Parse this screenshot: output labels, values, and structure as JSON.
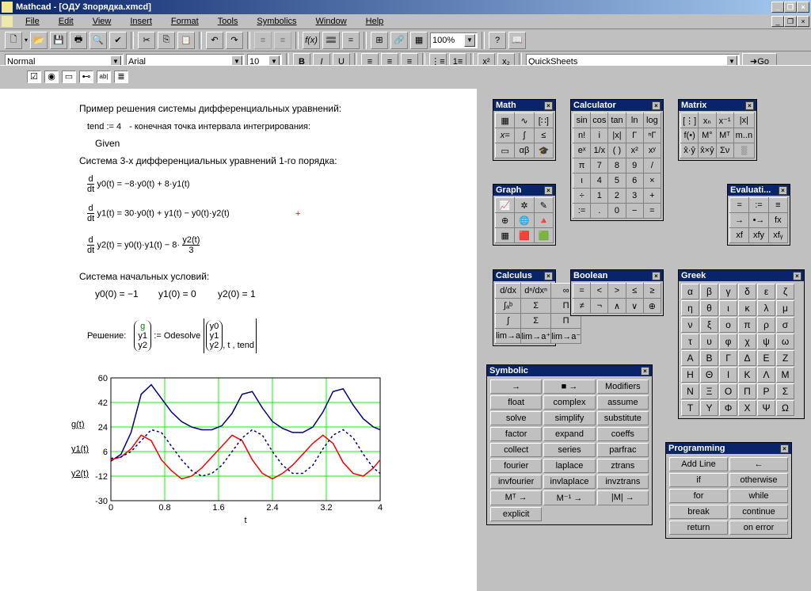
{
  "title": "Mathcad - [ОДУ 3порядка.xmcd]",
  "menu": [
    "File",
    "Edit",
    "View",
    "Insert",
    "Format",
    "Tools",
    "Symbolics",
    "Window",
    "Help"
  ],
  "style_combo": "Normal",
  "font_combo": "Arial",
  "size_combo": "10",
  "zoom_combo": "100%",
  "resources_combo": "QuickSheets",
  "go_label": "Go",
  "doc": {
    "l1": "Пример решения системы дифференциальных уравнений:",
    "l2a": "tend := 4",
    "l2b": "- конечная точка интервала интегрирования:",
    "l3": "Given",
    "l4": "Система  3-х дифференциальных уравнений 1-го порядка:",
    "eq1": "y0(t) = −8·y0(t) + 8·y1(t)",
    "eq2": "y1(t) = 30·y0(t) + y1(t) − y0(t)·y2(t)",
    "eq3_l": "y2(t) = y0(t)·y1(t) − 8·",
    "eq3_num": "y2(t)",
    "eq3_den": "3",
    "l5": "Система  начальных условий:",
    "ic1": "y0(0) = −1",
    "ic2": "y1(0) = 0",
    "ic3": "y2(0) = 1",
    "l6": "Решение:",
    "sol_v": [
      "g",
      "y1",
      "y2"
    ],
    "sol_assign": ":= Odesolve",
    "sol_u": [
      "y0",
      "y1",
      "y2"
    ],
    "sol_tail": ", t , tend",
    "legend": [
      "g(t)",
      "y1(t)",
      "y2(t)"
    ],
    "xlabel": "t"
  },
  "palettes": {
    "math_title": "Math",
    "graph_title": "Graph",
    "calc_title": "Calculator",
    "matrix_title": "Matrix",
    "eval_title": "Evaluati...",
    "calculus_title": "Calculus",
    "bool_title": "Boolean",
    "greek_title": "Greek",
    "symb_title": "Symbolic",
    "prog_title": "Programming",
    "calc_rows": [
      [
        "sin",
        "cos",
        "tan",
        "ln",
        "log"
      ],
      [
        "n!",
        "i",
        "|x|",
        "Γ",
        "ⁿΓ"
      ],
      [
        "eˣ",
        "1/x",
        "( )",
        "x²",
        "xʸ"
      ],
      [
        "π",
        "7",
        "8",
        "9",
        "/"
      ],
      [
        "ι",
        "4",
        "5",
        "6",
        "×"
      ],
      [
        "÷",
        "1",
        "2",
        "3",
        "+"
      ],
      [
        ":=",
        ".",
        "0",
        "−",
        "="
      ]
    ],
    "matrix_rows": [
      [
        "[⋮]",
        "xₙ",
        "x⁻¹",
        "|x|"
      ],
      [
        "f(•)",
        "M°",
        "Mᵀ",
        "m..n"
      ],
      [
        "x̂·ŷ",
        "x̂×ŷ",
        "Σν",
        "░"
      ]
    ],
    "eval_rows": [
      [
        "=",
        ":=",
        "≡"
      ],
      [
        "→",
        "•→",
        "fx"
      ],
      [
        "xf",
        "xfy",
        "xfᵧ"
      ]
    ],
    "calculus_rows": [
      [
        "d/dx",
        "dⁿ/dxⁿ",
        "∞"
      ],
      [
        "∫ₐᵇ",
        "Σ",
        "Π"
      ],
      [
        "∫",
        "Σ",
        "Π"
      ],
      [
        "lim→a",
        "lim→a⁺",
        "lim→a⁻"
      ]
    ],
    "bool_rows": [
      [
        "=",
        "<",
        ">",
        "≤",
        "≥"
      ],
      [
        "≠",
        "¬",
        "∧",
        "∨",
        "⊕"
      ]
    ],
    "greek": [
      "α",
      "β",
      "γ",
      "δ",
      "ε",
      "ζ",
      "η",
      "θ",
      "ι",
      "κ",
      "λ",
      "μ",
      "ν",
      "ξ",
      "ο",
      "π",
      "ρ",
      "σ",
      "τ",
      "υ",
      "φ",
      "χ",
      "ψ",
      "ω",
      "Α",
      "Β",
      "Γ",
      "Δ",
      "Ε",
      "Ζ",
      "Η",
      "Θ",
      "Ι",
      "Κ",
      "Λ",
      "Μ",
      "Ν",
      "Ξ",
      "Ο",
      "Π",
      "Ρ",
      "Σ",
      "Τ",
      "Υ",
      "Φ",
      "Χ",
      "Ψ",
      "Ω"
    ],
    "symb": [
      "→",
      "■ →",
      "Modifiers",
      "float",
      "complex",
      "assume",
      "solve",
      "simplify",
      "substitute",
      "factor",
      "expand",
      "coeffs",
      "collect",
      "series",
      "parfrac",
      "fourier",
      "laplace",
      "ztrans",
      "invfourier",
      "invlaplace",
      "invztrans",
      "Mᵀ →",
      "M⁻¹ →",
      "|M| →",
      "explicit",
      "",
      ""
    ],
    "prog": [
      "Add Line",
      "←",
      "if",
      "otherwise",
      "for",
      "while",
      "break",
      "continue",
      "return",
      "on error"
    ]
  },
  "chart_data": {
    "type": "line",
    "xlabel": "t",
    "ylabel": "",
    "xlim": [
      0,
      4
    ],
    "ylim": [
      -30,
      60
    ],
    "xticks": [
      0,
      0.8,
      1.6,
      2.4,
      3.2,
      4
    ],
    "yticks": [
      -30,
      -12,
      6,
      24,
      42,
      60
    ],
    "series": [
      {
        "name": "g(t)",
        "color": "#000080",
        "style": "solid"
      },
      {
        "name": "y1(t)",
        "color": "#ff0000",
        "style": "solid"
      },
      {
        "name": "y2(t)",
        "color": "#000080",
        "style": "dashed"
      }
    ],
    "x": [
      0.0,
      0.15,
      0.3,
      0.45,
      0.6,
      0.75,
      0.9,
      1.05,
      1.2,
      1.35,
      1.5,
      1.65,
      1.8,
      1.95,
      2.1,
      2.25,
      2.4,
      2.55,
      2.7,
      2.85,
      3.0,
      3.15,
      3.3,
      3.45,
      3.6,
      3.75,
      3.9,
      4.0
    ],
    "g": [
      -1,
      4,
      20,
      48,
      55,
      45,
      35,
      28,
      24,
      22,
      22,
      25,
      34,
      48,
      50,
      38,
      28,
      23,
      20,
      20,
      24,
      35,
      50,
      52,
      40,
      30,
      24,
      22
    ],
    "y1": [
      0,
      2,
      8,
      18,
      14,
      0,
      -8,
      -14,
      -12,
      -6,
      2,
      10,
      18,
      14,
      0,
      -10,
      -14,
      -10,
      -4,
      4,
      12,
      18,
      12,
      -2,
      -10,
      -12,
      -6,
      0
    ],
    "y2": [
      1,
      2,
      6,
      14,
      22,
      20,
      10,
      0,
      -8,
      -12,
      -10,
      -4,
      6,
      16,
      22,
      18,
      6,
      -4,
      -10,
      -10,
      -4,
      8,
      18,
      22,
      16,
      4,
      -6,
      -10
    ]
  }
}
